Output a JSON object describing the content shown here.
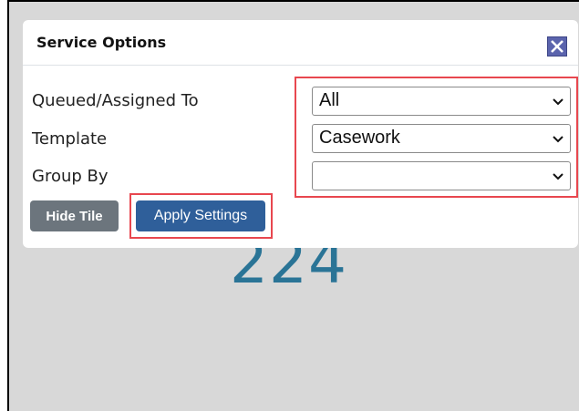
{
  "dialog": {
    "title": "Service Options",
    "close_icon": "close-x-icon"
  },
  "fields": [
    {
      "label": "Queued/Assigned To",
      "value": "All"
    },
    {
      "label": "Template",
      "value": "Casework"
    },
    {
      "label": "Group By",
      "value": ""
    }
  ],
  "buttons": {
    "hide_tile": "Hide Tile",
    "apply_settings": "Apply Settings"
  },
  "tile": {
    "count": "224"
  },
  "colors": {
    "highlight": "#e8474f",
    "apply_button": "#2f5f9a",
    "hide_button": "#6c757d",
    "close_button": "#5b64ad",
    "count_text": "#2a7496"
  }
}
